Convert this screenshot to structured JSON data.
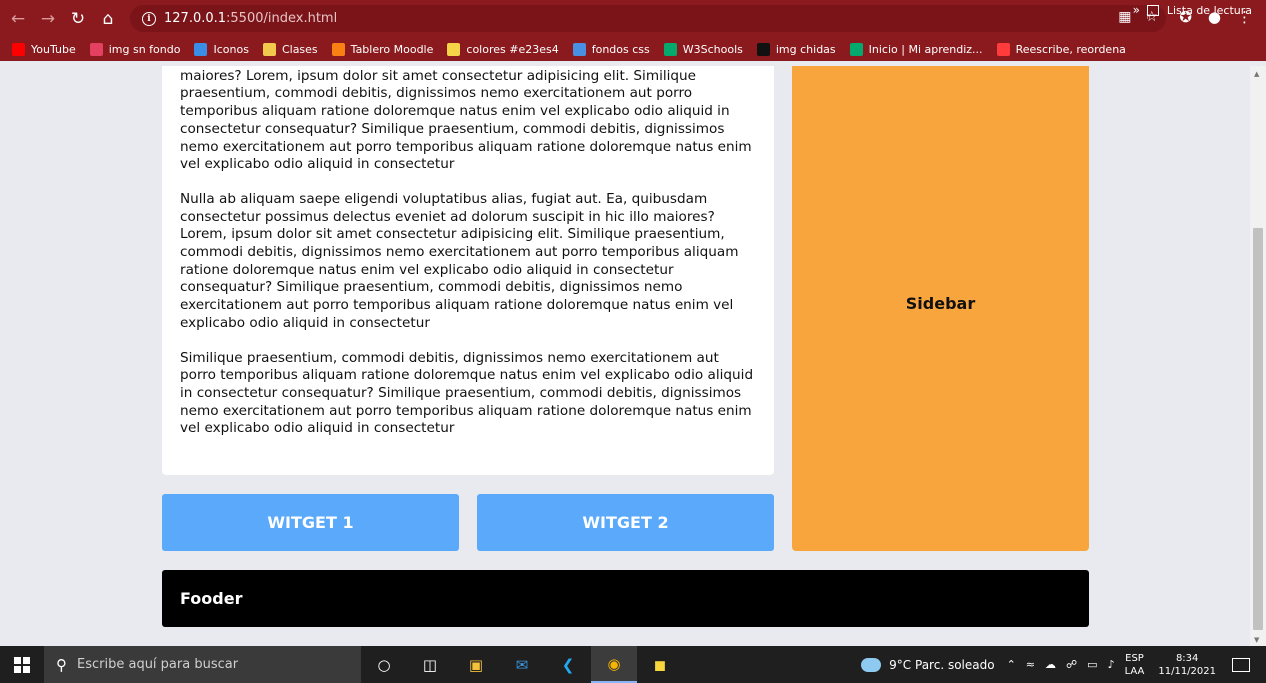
{
  "browser": {
    "url_host": "127.0.0.1",
    "url_path": ":5500/index.html",
    "bookmarks": [
      {
        "label": "YouTube",
        "color": "#ff0000"
      },
      {
        "label": "img sn fondo",
        "color": "#e4405f"
      },
      {
        "label": "Iconos",
        "color": "#3b8ee8"
      },
      {
        "label": "Clases",
        "color": "#f2c94c"
      },
      {
        "label": "Tablero Moodle",
        "color": "#f98012"
      },
      {
        "label": "colores #e23es4",
        "color": "#f5d547"
      },
      {
        "label": "fondos css",
        "color": "#4a90e2"
      },
      {
        "label": "W3Schools",
        "color": "#04aa6d"
      },
      {
        "label": "img chidas",
        "color": "#111111"
      },
      {
        "label": "Inicio | Mi aprendiz...",
        "color": "#04aa6d"
      },
      {
        "label": "Reescribe, reordena",
        "color": "#ff3b3b"
      }
    ],
    "more": "»",
    "reading_list": "Lista de lectura"
  },
  "page": {
    "paragraphs": [
      "quibusdam consectetur possimus delectus eveniet ad dolorum suscipit in hic illo maiores? Lorem, ipsum dolor sit amet consectetur adipisicing elit. Similique praesentium, commodi debitis, dignissimos nemo exercitationem aut porro temporibus aliquam ratione doloremque natus enim vel explicabo odio aliquid in consectetur consequatur? Similique praesentium, commodi debitis, dignissimos nemo exercitationem aut porro temporibus aliquam ratione doloremque natus enim vel explicabo odio aliquid in consectetur",
      "Nulla ab aliquam saepe eligendi voluptatibus alias, fugiat aut. Ea, quibusdam consectetur possimus delectus eveniet ad dolorum suscipit in hic illo maiores? Lorem, ipsum dolor sit amet consectetur adipisicing elit. Similique praesentium, commodi debitis, dignissimos nemo exercitationem aut porro temporibus aliquam ratione doloremque natus enim vel explicabo odio aliquid in consectetur consequatur? Similique praesentium, commodi debitis, dignissimos nemo exercitationem aut porro temporibus aliquam ratione doloremque natus enim vel explicabo odio aliquid in consectetur",
      "Similique praesentium, commodi debitis, dignissimos nemo exercitationem aut porro temporibus aliquam ratione doloremque natus enim vel explicabo odio aliquid in consectetur consequatur? Similique praesentium, commodi debitis, dignissimos nemo exercitationem aut porro temporibus aliquam ratione doloremque natus enim vel explicabo odio aliquid in consectetur"
    ],
    "sidebar": "Sidebar",
    "widget1": "WITGET 1",
    "widget2": "WITGET 2",
    "footer": "Fooder",
    "colors": {
      "sidebar": "#f9a53e",
      "widget": "#5aa9fb",
      "footer": "#000000"
    }
  },
  "taskbar": {
    "search_placeholder": "Escribe aquí para buscar",
    "weather": "9°C  Parc. soleado",
    "lang_top": "ESP",
    "lang_bottom": "LAA",
    "time": "8:34",
    "date": "11/11/2021"
  }
}
